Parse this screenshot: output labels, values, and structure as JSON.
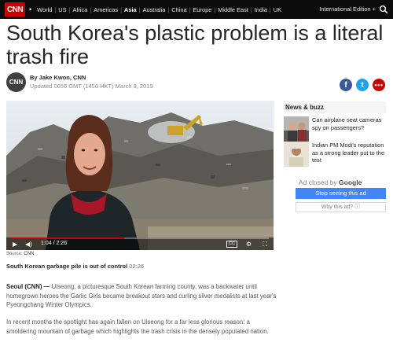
{
  "nav": {
    "logo": "CNN",
    "links": [
      "World",
      "US",
      "Africa",
      "Americas",
      "Asia",
      "Australia",
      "China",
      "Europe",
      "Middle East",
      "India",
      "UK"
    ],
    "active": "Asia",
    "edition": "International Edition +"
  },
  "article": {
    "headline": "South Korea's plastic problem is a literal trash fire",
    "avatar": "CNN",
    "byline_prefix": "By ",
    "author": "Jake Kwon",
    "byline_suffix": ", CNN",
    "updated": "Updated 0656 GMT (1456 HKT) March 3, 2019",
    "share": {
      "facebook": "f",
      "twitter": "t",
      "more": "•••"
    }
  },
  "video": {
    "timecode": "1:04 / 2:26",
    "progress": 0.44,
    "cc_label": "CC",
    "source_label": "Source: ",
    "source_value": "CNN",
    "caption_title": "South Korean garbage pile is out of control",
    "caption_duration": " 02:26"
  },
  "body": {
    "p1_lead": "Seoul (CNN) —",
    "p1_text": " Uiseong, a picturesque South Korean farming county, was a backwater until homegrown heroes the Garlic Girls became breakout stars and curling silver medalists at last year's Pyeongchang Winter Olympics.",
    "p2_text": "In recent months the spotlight has again fallen on Uiseong for a far less glorious reason: a smoldering mountain of garbage which highlights the trash crisis in the densely populated nation."
  },
  "sidebar": {
    "title": "News & buzz",
    "items": [
      {
        "label": "Can airplane seat cameras spy on passengers?"
      },
      {
        "label": "Indian PM Modi's reputation as a strong leader put to the test"
      }
    ],
    "ad_closed_prefix": "Ad closed by ",
    "ad_closed_brand": "Google",
    "stop_button": "Stop seeing this ad",
    "why_ad": "Why this ad? ⓘ"
  },
  "colors": {
    "brand": "#cc0000",
    "nav_bg": "#0c0c0c",
    "google_blue": "#4285f4"
  }
}
